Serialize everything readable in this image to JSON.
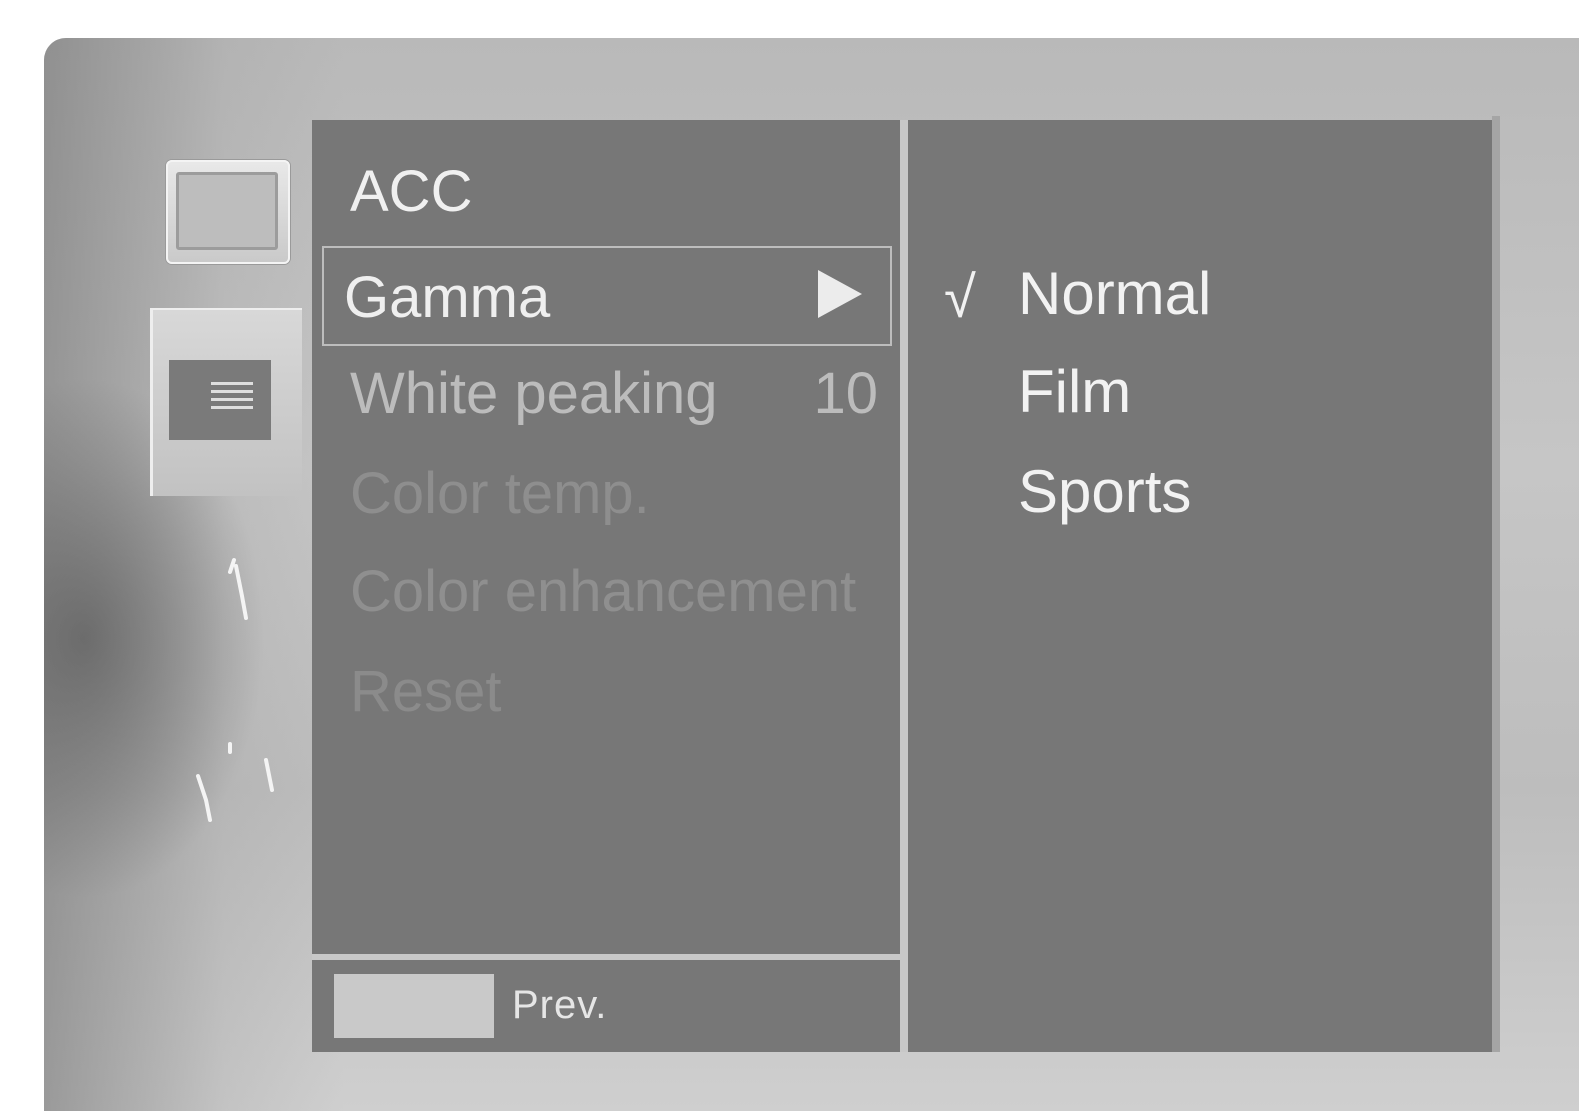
{
  "menu": {
    "items": [
      {
        "label": "ACC"
      },
      {
        "label": "Gamma"
      },
      {
        "label": "White peaking",
        "value": "10"
      },
      {
        "label": "Color temp."
      },
      {
        "label": "Color enhancement"
      },
      {
        "label": "Reset"
      }
    ],
    "selected_index": 1
  },
  "submenu": {
    "options": [
      {
        "label": "Normal",
        "check": "√"
      },
      {
        "label": "Film"
      },
      {
        "label": "Sports"
      }
    ],
    "selected_option": "Normal"
  },
  "footer": {
    "prev_label": "Prev."
  },
  "sidebar": {
    "icons": [
      {
        "name": "screen-icon",
        "active": false
      },
      {
        "name": "picture-icon",
        "active": true
      },
      {
        "name": "audio-icon",
        "active": false
      },
      {
        "name": "time-icon",
        "active": false
      }
    ]
  }
}
